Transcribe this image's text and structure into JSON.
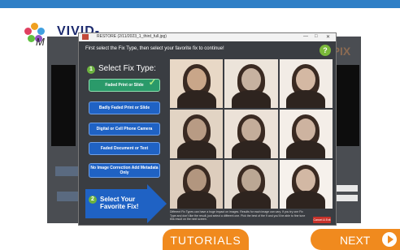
{
  "app": {
    "brand_name": "VIVID-PIX",
    "brand_initial": "M",
    "background_logo": "-PIX",
    "window_title_hint": "RESTORE"
  },
  "dialog": {
    "title": "RESTORE (2/11/2023_1_third_full.jpg)",
    "window_controls": [
      "—",
      "□",
      "✕"
    ],
    "instruction": "First select the Fix Type, then select your favorite fix to continue!",
    "help_label": "?",
    "step1": {
      "number": "1",
      "label": "Select Fix Type:"
    },
    "fix_types": [
      {
        "label": "Faded Print or Slide",
        "selected": true
      },
      {
        "label": "Badly Faded Print or Slide",
        "selected": false
      },
      {
        "label": "Digital or Cell Phone Camera",
        "selected": false
      },
      {
        "label": "Faded Document or Text",
        "selected": false
      },
      {
        "label": "No Image Correction Add Metadata Only",
        "selected": false
      }
    ],
    "step2": {
      "number": "2",
      "label": "Select Your Favorite Fix!"
    },
    "note": "Different Fix Types can have a huge impact on images. Results for each image can vary. If you try one Fix Type and don't like the result, just select a different one. Pick the best of the 9 and you'll be able to fine tune this result on the next screen.",
    "cancel_label": "Cancel & Exit",
    "photos": [
      {
        "tone": "#c9a689",
        "bg": "#e8d8c6"
      },
      {
        "tone": "#c7b2a0",
        "bg": "#ece4da"
      },
      {
        "tone": "#d4b8a3",
        "bg": "#f2ece6"
      },
      {
        "tone": "#b89b84",
        "bg": "#e2d4c4"
      },
      {
        "tone": "#c4ad9a",
        "bg": "#ece2d8"
      },
      {
        "tone": "#cdb3a0",
        "bg": "#f4eee8"
      },
      {
        "tone": "#b2967f",
        "bg": "#ddcdbd"
      },
      {
        "tone": "#bba794",
        "bg": "#e6ddd3"
      },
      {
        "tone": "#d2b8a4",
        "bg": "#f6f1ec"
      }
    ]
  },
  "footer": {
    "tutorials_label": "TUTORIALS",
    "next_label": "NEXT"
  },
  "colors": {
    "topbar": "#2f7fc6",
    "accent_orange": "#f08a1e",
    "button_blue": "#1f62c4",
    "step_green": "#6db33f"
  }
}
